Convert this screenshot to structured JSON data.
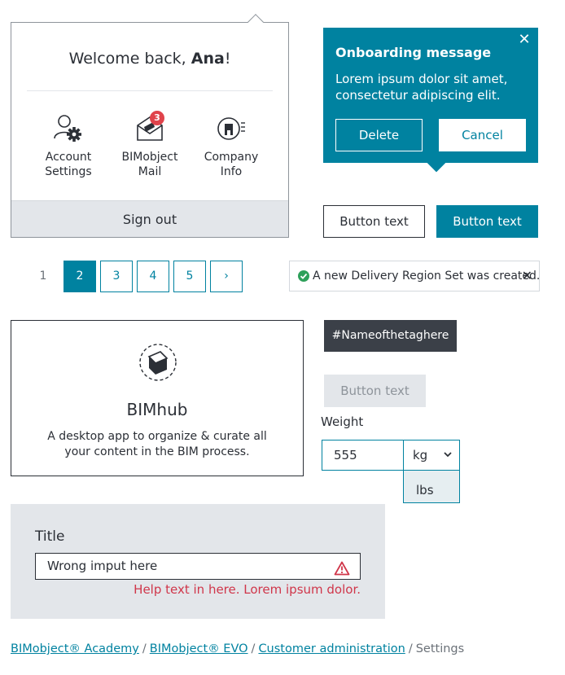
{
  "welcome": {
    "greeting": "Welcome back, ",
    "user_name": "Ana",
    "exclamation": "!",
    "menu": [
      {
        "line1": "Account",
        "line2": "Settings",
        "icon": "account-settings-icon"
      },
      {
        "line1": "BIMobject",
        "line2": "Mail",
        "icon": "mail-icon",
        "badge": "3"
      },
      {
        "line1": "Company",
        "line2": "Info",
        "icon": "company-info-icon"
      }
    ],
    "sign_out": "Sign out"
  },
  "onboarding": {
    "title": "Onboarding message",
    "body": "Lorem ipsum dolor sit amet, consectetur adipiscing elit.",
    "close": "✕",
    "delete_label": "Delete",
    "cancel_label": "Cancel"
  },
  "buttons": {
    "secondary_label": "Button text",
    "primary_label": "Button text",
    "disabled_label": "Button text"
  },
  "pagination": {
    "pages": [
      "1",
      "2",
      "3",
      "4",
      "5"
    ],
    "active": "2",
    "next": "›"
  },
  "toast": {
    "message": "A new Delivery Region Set was created.",
    "close": "✕"
  },
  "bimhub": {
    "title": "BIMhub",
    "description": "A desktop app to organize & curate all your content in the BIM process."
  },
  "tag": {
    "label": "#Nameofthetaghere"
  },
  "weight": {
    "label": "Weight",
    "value": "555",
    "unit_selected": "kg",
    "unit_option": "lbs"
  },
  "form": {
    "title": "Title",
    "value": "Wrong imput here",
    "help": "Help text in here. Lorem ipsum dolor."
  },
  "breadcrumb": {
    "items": [
      "BIMobject® Academy",
      "BIMobject® EVO",
      "Customer administration"
    ],
    "separator": "/",
    "current": "Settings"
  },
  "colors": {
    "accent": "#0082a0",
    "dark": "#2b2f36",
    "error": "#d0364a",
    "success": "#2ea05a",
    "panel_gray": "#e3e6ea",
    "badge": "#e0434b"
  }
}
